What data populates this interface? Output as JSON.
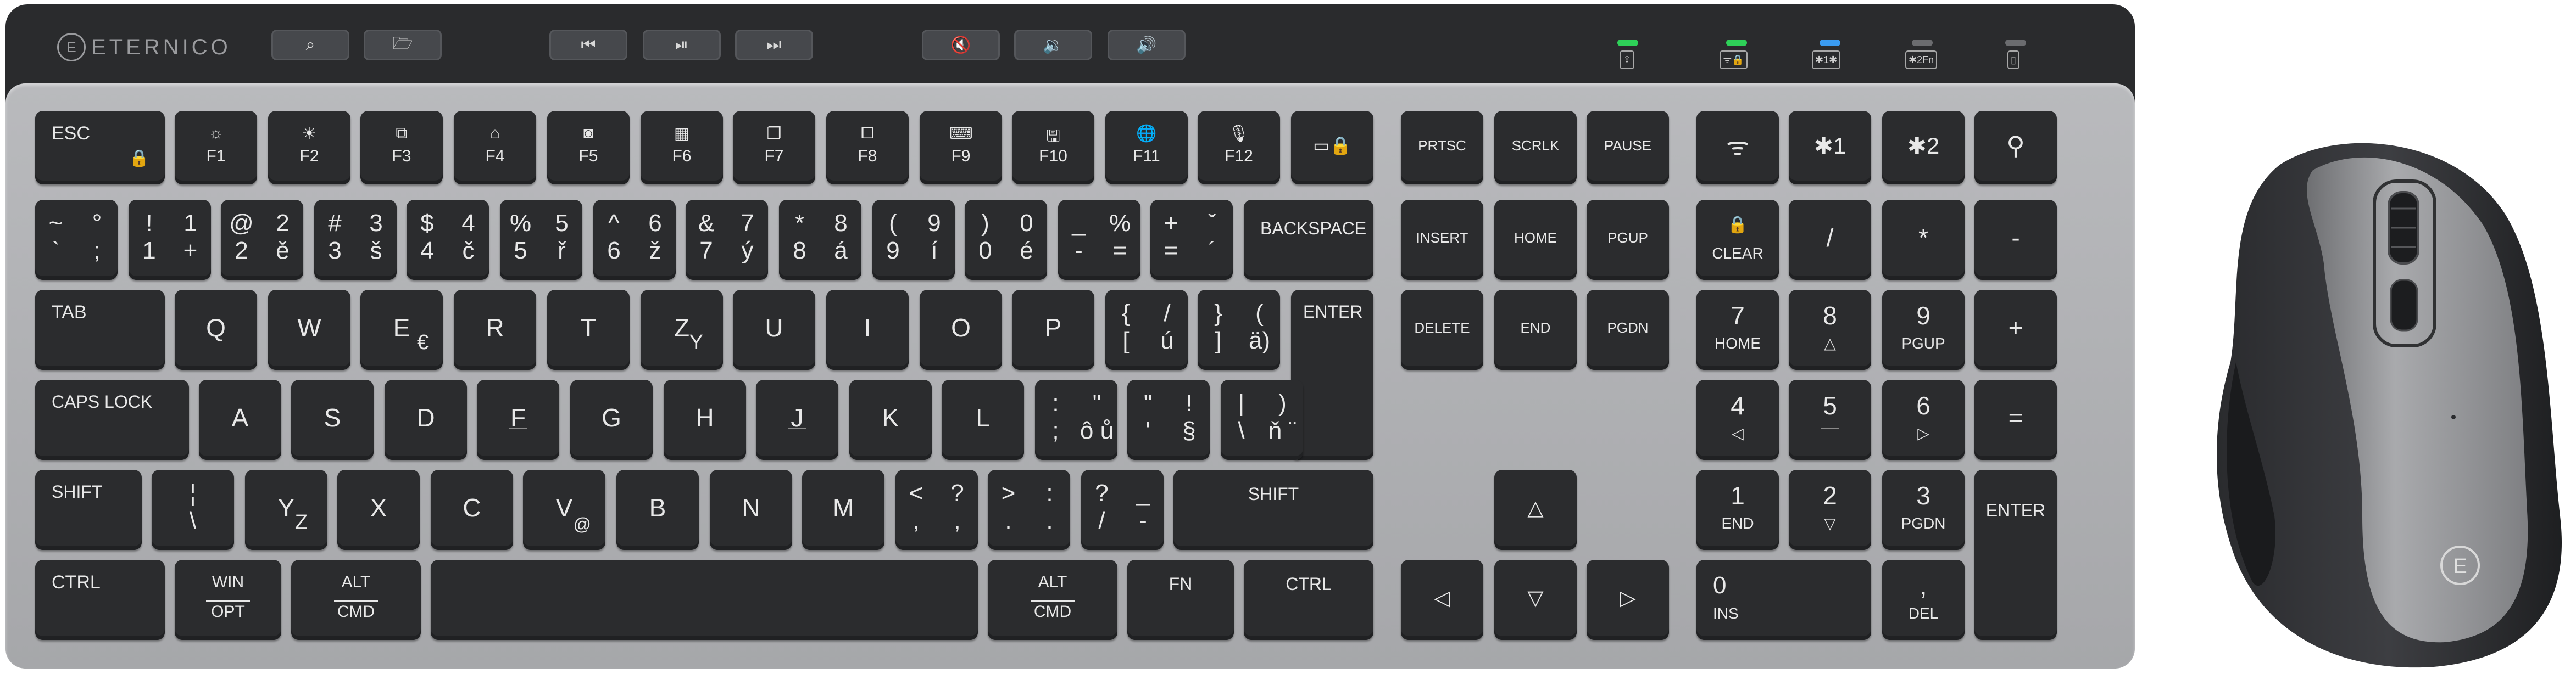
{
  "brand": "ETERNICO",
  "brand_mark": "E",
  "top_bar": {
    "function_strip": [
      "⌕",
      "🗁",
      "⏮",
      "⏯",
      "⏭",
      "🔇",
      "🔉",
      "🔊"
    ],
    "indicators": [
      {
        "color": "#2ed158",
        "label": "⇪"
      },
      {
        "color": "#2ed158",
        "label": "ᯤ🔒"
      },
      {
        "color": "#3a9bf0",
        "label": "✱1✱"
      },
      {
        "color": "#6b6c6f",
        "label": "✱2Fn"
      },
      {
        "color": "#6b6c6f",
        "label": "▯"
      }
    ]
  },
  "keys": {
    "esc": "ESC",
    "lock": "🔒",
    "f1": "F1",
    "f2": "F2",
    "f3": "F3",
    "f4": "F4",
    "f5": "F5",
    "f6": "F6",
    "f7": "F7",
    "f8": "F8",
    "f9": "F9",
    "f10": "F10",
    "f11": "F11",
    "f12": "F12",
    "f1i": "☼",
    "f2i": "☀",
    "f3i": "⧉",
    "f4i": "⌂",
    "f5i": "◙",
    "f6i": "▦",
    "f7i": "❐",
    "f8i": "⧠",
    "f9i": "⌨",
    "f10i": "🖫",
    "f11i": "🌐",
    "f12i": "🎙",
    "screen": "▭🔒",
    "prtsc": "PRTSC",
    "scrlk": "SCRLK",
    "pause": "PAUSE",
    "wifi": "ᯤ",
    "bt1": "✱1",
    "bt2": "✱2",
    "usb": "⚲",
    "n1": [
      "~",
      "°",
      "`",
      ";"
    ],
    "n2": [
      "!",
      "1",
      "1",
      "+"
    ],
    "n3": [
      "@",
      "2",
      "2",
      "ě"
    ],
    "n4": [
      "#",
      "3",
      "3",
      "š"
    ],
    "n5": [
      "$",
      "4",
      "4",
      "č"
    ],
    "n6": [
      "%",
      "5",
      "5",
      "ř"
    ],
    "n7": [
      "^",
      "6",
      "6",
      "ž"
    ],
    "n8": [
      "&",
      "7",
      "7",
      "ý"
    ],
    "n9": [
      "*",
      "8",
      "8",
      "á"
    ],
    "n10": [
      "(",
      "9",
      "9",
      "í"
    ],
    "n11": [
      ")",
      "0",
      "0",
      "é"
    ],
    "n12": [
      "_",
      "%",
      "-",
      "="
    ],
    "n13": [
      "+",
      "ˇ",
      "=",
      "´"
    ],
    "backspace": "BACKSPACE",
    "insert": "INSERT",
    "home": "HOME",
    "pgup": "PGUP",
    "clear": "CLEAR",
    "clear_icon": "🔒",
    "slash": "/",
    "star": "*",
    "minus": "-",
    "tab": "TAB",
    "q": "Q",
    "w": "W",
    "e": "E",
    "euro": "€",
    "r": "R",
    "t": "T",
    "z": "Z",
    "zsub": "Y",
    "u": "U",
    "i": "I",
    "o": "O",
    "p": "P",
    "br1": [
      "{",
      "/",
      "[",
      "ú"
    ],
    "br2": [
      "}",
      "(",
      "]",
      "ä)"
    ],
    "enter": "ENTER",
    "delete": "DELETE",
    "end": "END",
    "pgdn": "PGDN",
    "np7": "7",
    "np7s": "HOME",
    "np8": "8",
    "np8s": "△",
    "np9": "9",
    "np9s": "PGUP",
    "plus": "+",
    "caps": "CAPS LOCK",
    "a": "A",
    "s": "S",
    "d": "D",
    "f": "F",
    "g": "G",
    "h": "H",
    "j": "J",
    "k": "K",
    "l": "L",
    "semi": [
      ":",
      "\"",
      ";",
      "ô ů"
    ],
    "quote": [
      "\"",
      "!",
      "'",
      "§"
    ],
    "pipe": [
      "|",
      ")",
      "\\",
      "ň ¨"
    ],
    "np4": "4",
    "np4s": "◁",
    "np5": "5",
    "np6": "6",
    "np6s": "▷",
    "equals": "=",
    "shift": "SHIFT",
    "pipe2": [
      "¦",
      "\\"
    ],
    "y": "Y",
    "ysub": "Z",
    "x": "X",
    "c": "C",
    "v": "V",
    "vsub": "@",
    "b": "B",
    "n": "N",
    "m": "M",
    "comma": [
      "<",
      "?",
      ",",
      ","
    ],
    "period": [
      ">",
      ":",
      ".",
      "."
    ],
    "qmark": [
      "?",
      "_",
      "/",
      "-"
    ],
    "up": "△",
    "np1": "1",
    "np1s": "END",
    "np2": "2",
    "np2s": "▽",
    "np3": "3",
    "np3s": "PGDN",
    "npenter": "ENTER",
    "ctrl": "CTRL",
    "win": "WIN",
    "opt": "OPT",
    "alt": "ALT",
    "cmd": "CMD",
    "fn": "FN",
    "left": "◁",
    "down": "▽",
    "right": "▷",
    "np0": "0",
    "ins": "INS",
    "npdot": ",",
    "del": "DEL"
  },
  "mouse": {
    "logo": "E"
  }
}
